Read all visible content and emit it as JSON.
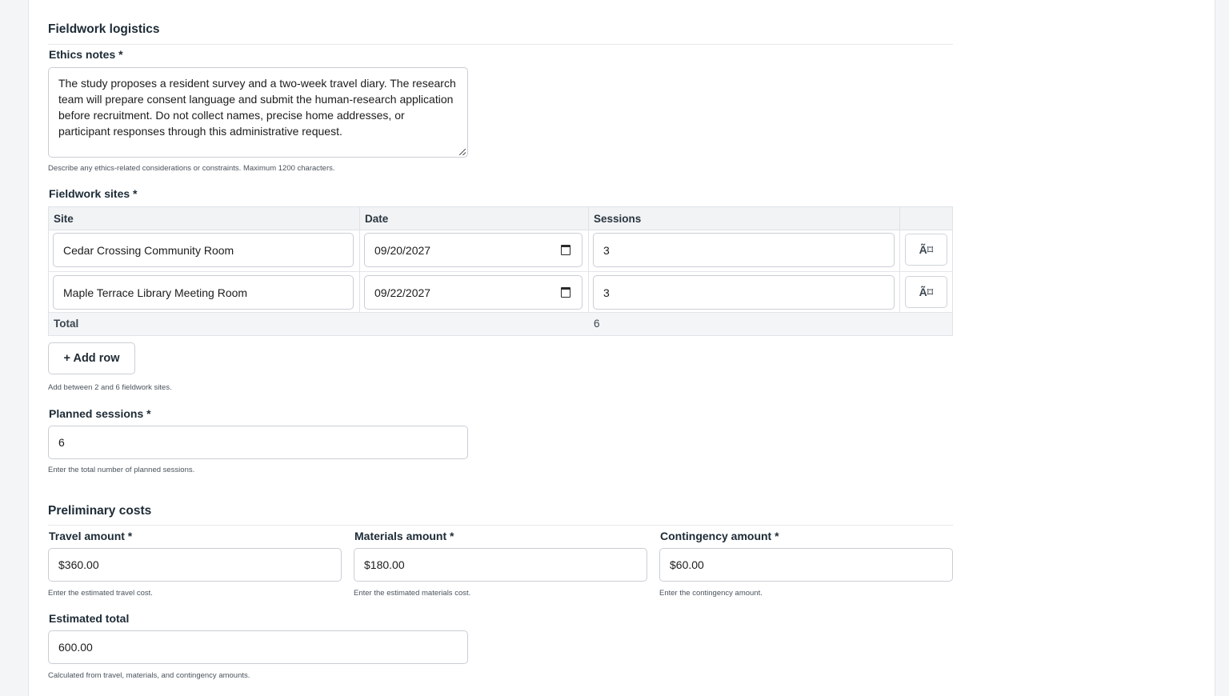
{
  "fieldwork": {
    "section_title": "Fieldwork logistics",
    "ethics": {
      "label": "Ethics notes *",
      "value": "The study proposes a resident survey and a two-week travel diary. The research team will prepare consent language and submit the human-research application before recruitment. Do not collect names, precise home addresses, or participant responses through this administrative request.",
      "help": "Describe any ethics-related considerations or constraints. Maximum 1200 characters."
    },
    "sites": {
      "label": "Fieldwork sites *",
      "columns": [
        "Site",
        "Date",
        "Sessions"
      ],
      "rows": [
        {
          "site": "Cedar Crossing Community Room",
          "date": "09/20/2027",
          "sessions": "3",
          "action": "Ã⌑"
        },
        {
          "site": "Maple Terrace Library Meeting Room",
          "date": "09/22/2027",
          "sessions": "3",
          "action": "Ã⌑"
        }
      ],
      "total_label": "Total",
      "total_sessions": "6",
      "add_row_label": "+ Add row",
      "help": "Add between 2 and 6 fieldwork sites."
    },
    "planned": {
      "label": "Planned sessions *",
      "value": "6",
      "help": "Enter the total number of planned sessions."
    }
  },
  "costs": {
    "section_title": "Preliminary costs",
    "travel": {
      "label": "Travel amount *",
      "value": "$360.00",
      "help": "Enter the estimated travel cost."
    },
    "materials": {
      "label": "Materials amount *",
      "value": "$180.00",
      "help": "Enter the estimated materials cost."
    },
    "contingency": {
      "label": "Contingency amount *",
      "value": "$60.00",
      "help": "Enter the contingency amount."
    },
    "total": {
      "label": "Estimated total",
      "value": "600.00",
      "help": "Calculated from travel, materials, and contingency amounts."
    }
  },
  "icons": {
    "date": "calendar-icon",
    "delete": "remove-row-icon"
  }
}
